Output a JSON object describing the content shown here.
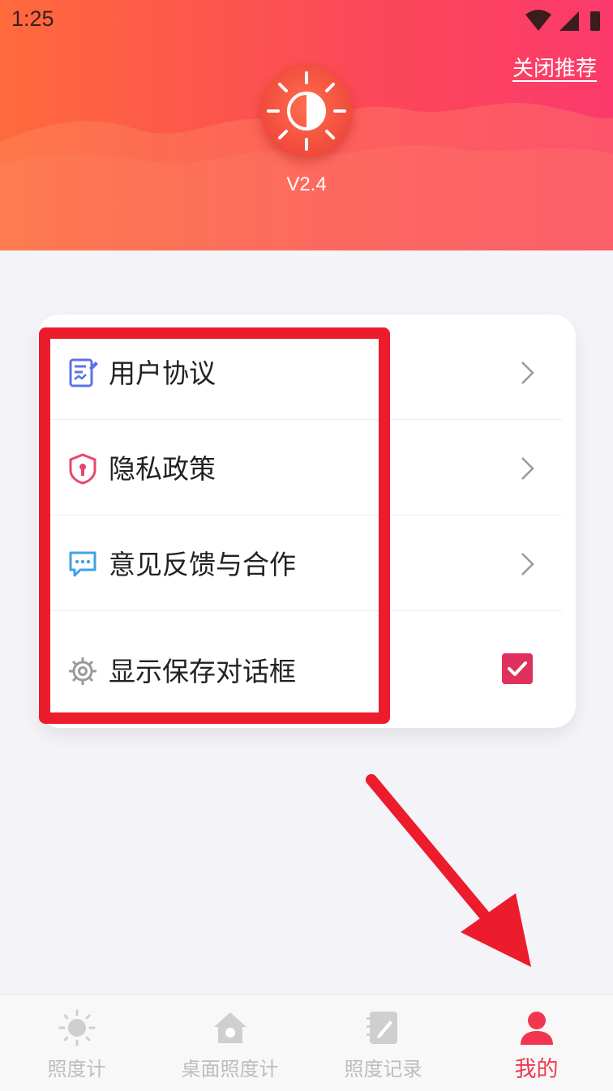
{
  "status_bar": {
    "time": "1:25"
  },
  "header": {
    "close_recommend": "关闭推荐",
    "version": "V2.4",
    "logo_icon": "sun-contrast-icon",
    "gradient": [
      "#fe6a3c",
      "#fb3a6b"
    ]
  },
  "menu": {
    "items": [
      {
        "label": "用户协议",
        "icon": "document-edit-icon",
        "icon_color": "#5b73e6",
        "accessory": "chevron"
      },
      {
        "label": "隐私政策",
        "icon": "shield-lock-icon",
        "icon_color": "#e8476b",
        "accessory": "chevron"
      },
      {
        "label": "意见反馈与合作",
        "icon": "chat-bubble-icon",
        "icon_color": "#3ea3e6",
        "accessory": "chevron"
      },
      {
        "label": "显示保存对话框",
        "icon": "gear-icon",
        "icon_color": "#9a9a9a",
        "accessory": "checkbox",
        "checked": true
      }
    ]
  },
  "annotation": {
    "highlight_color": "#ec1c2c"
  },
  "bottom_nav": {
    "items": [
      {
        "label": "照度计",
        "icon": "sun-icon",
        "active": false
      },
      {
        "label": "桌面照度计",
        "icon": "house-sun-icon",
        "active": false
      },
      {
        "label": "照度记录",
        "icon": "notebook-icon",
        "active": false
      },
      {
        "label": "我的",
        "icon": "person-icon",
        "active": true
      }
    ],
    "active_color": "#f2364f",
    "inactive_color": "#bdbdbd"
  }
}
